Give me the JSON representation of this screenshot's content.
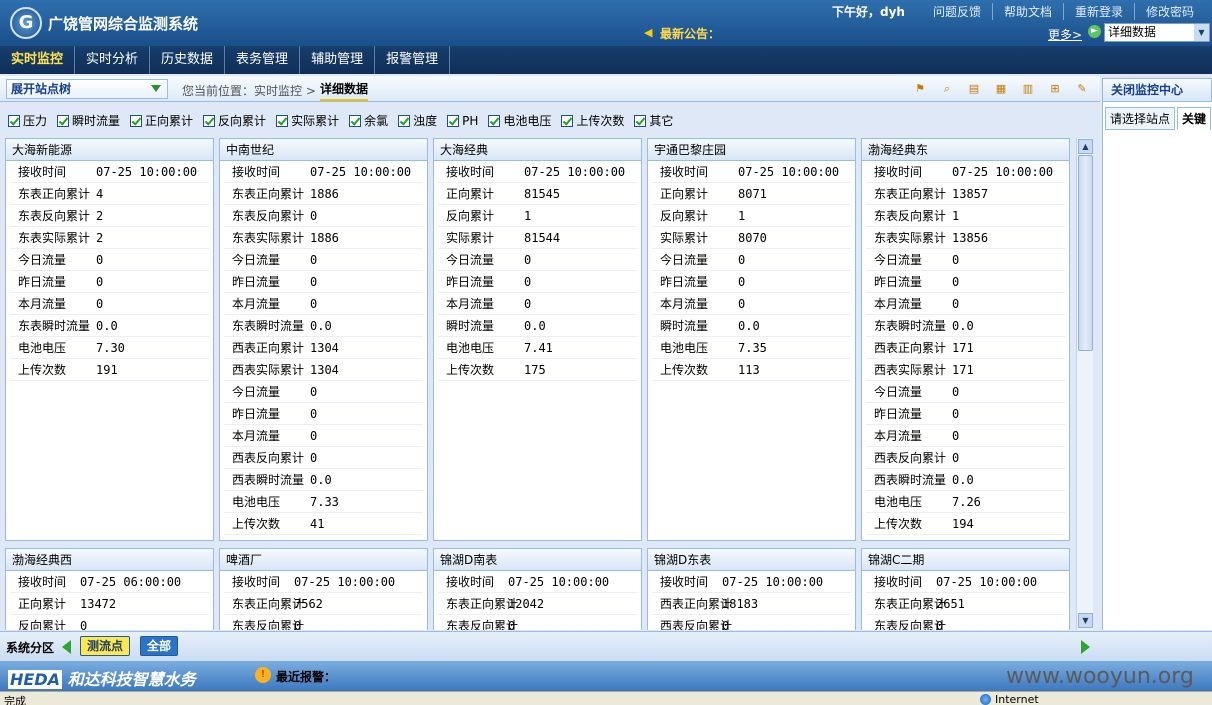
{
  "header": {
    "title": "广饶管网综合监测系统",
    "notice_label": "最新公告：",
    "greeting": "下午好，dyh",
    "links": [
      "问题反馈",
      "帮助文档",
      "重新登录",
      "修改密码"
    ],
    "more_link": "更多>",
    "view_select": "详细数据"
  },
  "nav": {
    "items": [
      "实时监控",
      "实时分析",
      "历史数据",
      "表务管理",
      "辅助管理",
      "报警管理"
    ],
    "active": "实时监控"
  },
  "toolbar": {
    "tree_select": "展开站点树",
    "breadcrumb_prefix": "您当前位置：实时监控  >",
    "breadcrumb_current": "详细数据"
  },
  "right_panel": {
    "title": "关闭监控中心",
    "tabs": [
      "请选择站点",
      "关键"
    ]
  },
  "filters": [
    "压力",
    "瞬时流量",
    "正向累计",
    "反向累计",
    "实际累计",
    "余氯",
    "浊度",
    "PH",
    "电池电压",
    "上传次数",
    "其它"
  ],
  "stations_row1": [
    {
      "name": "大海新能源",
      "rows": [
        [
          "接收时间",
          "07-25 10:00:00"
        ],
        [
          "东表正向累计",
          "4"
        ],
        [
          "东表反向累计",
          "2"
        ],
        [
          "东表实际累计",
          "2"
        ],
        [
          "今日流量",
          "0"
        ],
        [
          "昨日流量",
          "0"
        ],
        [
          "本月流量",
          "0"
        ],
        [
          "东表瞬时流量",
          "0.0"
        ],
        [
          "电池电压",
          "7.30"
        ],
        [
          "上传次数",
          "191"
        ]
      ]
    },
    {
      "name": "中南世纪",
      "rows": [
        [
          "接收时间",
          "07-25 10:00:00"
        ],
        [
          "东表正向累计",
          "1886"
        ],
        [
          "东表反向累计",
          "0"
        ],
        [
          "东表实际累计",
          "1886"
        ],
        [
          "今日流量",
          "0"
        ],
        [
          "昨日流量",
          "0"
        ],
        [
          "本月流量",
          "0"
        ],
        [
          "东表瞬时流量",
          "0.0"
        ],
        [
          "西表正向累计",
          "1304"
        ],
        [
          "西表实际累计",
          "1304"
        ],
        [
          "今日流量",
          "0"
        ],
        [
          "昨日流量",
          "0"
        ],
        [
          "本月流量",
          "0"
        ],
        [
          "西表反向累计",
          "0"
        ],
        [
          "西表瞬时流量",
          "0.0"
        ],
        [
          "电池电压",
          "7.33"
        ],
        [
          "上传次数",
          "41"
        ]
      ]
    },
    {
      "name": "大海经典",
      "rows": [
        [
          "接收时间",
          "07-25 10:00:00"
        ],
        [
          "正向累计",
          "81545"
        ],
        [
          "反向累计",
          "1"
        ],
        [
          "实际累计",
          "81544"
        ],
        [
          "今日流量",
          "0"
        ],
        [
          "昨日流量",
          "0"
        ],
        [
          "本月流量",
          "0"
        ],
        [
          "瞬时流量",
          "0.0"
        ],
        [
          "电池电压",
          "7.41"
        ],
        [
          "上传次数",
          "175"
        ]
      ]
    },
    {
      "name": "宇通巴黎庄园",
      "rows": [
        [
          "接收时间",
          "07-25 10:00:00"
        ],
        [
          "正向累计",
          "8071"
        ],
        [
          "反向累计",
          "1"
        ],
        [
          "实际累计",
          "8070"
        ],
        [
          "今日流量",
          "0"
        ],
        [
          "昨日流量",
          "0"
        ],
        [
          "本月流量",
          "0"
        ],
        [
          "瞬时流量",
          "0.0"
        ],
        [
          "电池电压",
          "7.35"
        ],
        [
          "上传次数",
          "113"
        ]
      ]
    },
    {
      "name": "渤海经典东",
      "rows": [
        [
          "接收时间",
          "07-25 10:00:00"
        ],
        [
          "东表正向累计",
          "13857"
        ],
        [
          "东表反向累计",
          "1"
        ],
        [
          "东表实际累计",
          "13856"
        ],
        [
          "今日流量",
          "0"
        ],
        [
          "昨日流量",
          "0"
        ],
        [
          "本月流量",
          "0"
        ],
        [
          "东表瞬时流量",
          "0.0"
        ],
        [
          "西表正向累计",
          "171"
        ],
        [
          "西表实际累计",
          "171"
        ],
        [
          "今日流量",
          "0"
        ],
        [
          "昨日流量",
          "0"
        ],
        [
          "本月流量",
          "0"
        ],
        [
          "西表反向累计",
          "0"
        ],
        [
          "西表瞬时流量",
          "0.0"
        ],
        [
          "电池电压",
          "7.26"
        ],
        [
          "上传次数",
          "194"
        ]
      ]
    }
  ],
  "stations_row2": [
    {
      "name": "渤海经典西",
      "rows": [
        [
          "接收时间",
          "07-25 06:00:00"
        ],
        [
          "正向累计",
          "13472"
        ],
        [
          "反向累计",
          "0"
        ]
      ]
    },
    {
      "name": "啤酒厂",
      "rows": [
        [
          "接收时间",
          "07-25 10:00:00"
        ],
        [
          "东表正向累计",
          "7562"
        ],
        [
          "东表反向累计",
          "0"
        ]
      ]
    },
    {
      "name": "锦湖D南表",
      "rows": [
        [
          "接收时间",
          "07-25 10:00:00"
        ],
        [
          "东表正向累计",
          "12042"
        ],
        [
          "东表反向累计",
          "0"
        ]
      ]
    },
    {
      "name": "锦湖D东表",
      "rows": [
        [
          "接收时间",
          "07-25 10:00:00"
        ],
        [
          "西表正向累计",
          "18183"
        ],
        [
          "西表反向累计",
          "0"
        ]
      ]
    },
    {
      "name": "锦湖C二期",
      "rows": [
        [
          "接收时间",
          "07-25 10:00:00"
        ],
        [
          "东表正向累计",
          "2651"
        ],
        [
          "东表反向累计",
          "0"
        ]
      ]
    }
  ],
  "bottombar": {
    "label": "系统分区",
    "btn_points": "测流点",
    "btn_all": "全部"
  },
  "footer": {
    "brand_prefix": "HEDA",
    "brand_text": "和达科技智慧水务",
    "alarm_label": "最近报警：",
    "watermark": "www.wooyun.org"
  },
  "statusbar": {
    "status": "完成",
    "zone": "Internet"
  },
  "icons": [
    "search-icon",
    "edit-icon",
    "copy-icon",
    "export-icon",
    "grid-icon",
    "tree-icon",
    "refresh-icon"
  ]
}
